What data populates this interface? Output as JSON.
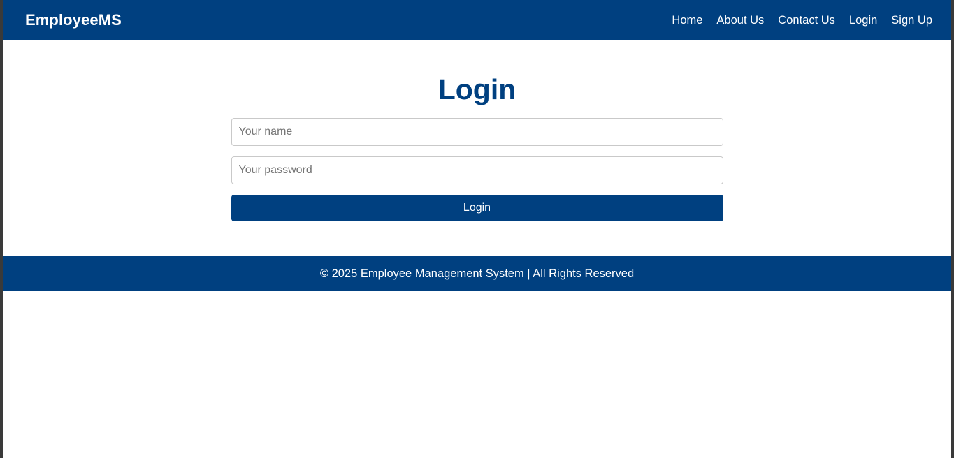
{
  "navbar": {
    "brand": "EmployeeMS",
    "links": [
      "Home",
      "About Us",
      "Contact Us",
      "Login",
      "Sign Up"
    ]
  },
  "login": {
    "title": "Login",
    "name_placeholder": "Your name",
    "name_value": "",
    "password_placeholder": "Your password",
    "password_value": "",
    "submit_label": "Login"
  },
  "footer": {
    "text": "© 2025 Employee Management System | All Rights Reserved"
  },
  "colors": {
    "primary": "#004080",
    "background": "#ffffff"
  }
}
